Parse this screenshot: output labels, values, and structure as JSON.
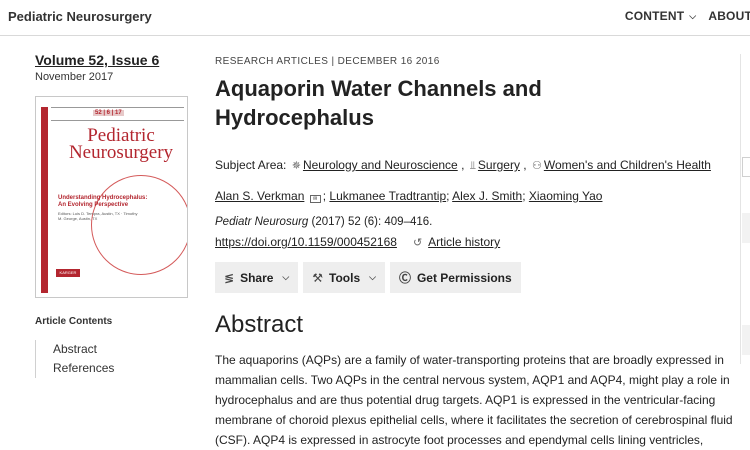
{
  "header": {
    "brand": "Pediatric Neurosurgery",
    "nav": [
      {
        "label": "CONTENT"
      },
      {
        "label": "ABOUT"
      }
    ]
  },
  "issue": {
    "volume": "Volume 52, Issue 6",
    "date": "November 2017"
  },
  "cover": {
    "title_line1": "Pediatric",
    "title_line2": "Neurosurgery",
    "issue_numbers": "52 | 6 | 17",
    "subtitle": "Understanding Hydrocephalus: An Evolving Perspective",
    "editors": "Editors: Luis D. Tempra, Austin, TX · Timothy M. George, Austin, TX",
    "publisher": "KARGER"
  },
  "contents": {
    "heading": "Article Contents",
    "items": [
      {
        "label": "Abstract"
      },
      {
        "label": "References"
      }
    ]
  },
  "article": {
    "kicker": "RESEARCH ARTICLES |  DECEMBER 16 2016",
    "title": "Aquaporin Water Channels and Hydrocephalus",
    "subject_label": "Subject Area:",
    "subjects": [
      {
        "label": "Neurology and Neuroscience"
      },
      {
        "label": "Surgery"
      },
      {
        "label": "Women's and Children's Health"
      }
    ],
    "authors": [
      {
        "name": "Alan S. Verkman"
      },
      {
        "name": "Lukmanee Tradtrantip"
      },
      {
        "name": "Alex J. Smith"
      },
      {
        "name": "Xiaoming Yao"
      }
    ],
    "citation_journal": "Pediatr Neurosurg",
    "citation_rest": " (2017) 52 (6): 409–416.",
    "doi": "https://doi.org/10.1159/000452168",
    "history": "Article history",
    "actions": {
      "share": "Share",
      "tools": "Tools",
      "permissions": "Get Permissions"
    },
    "abstract_heading": "Abstract",
    "abstract_text": "The aquaporins (AQPs) are a family of water-transporting proteins that are broadly expressed in mammalian cells. Two AQPs in the central nervous system, AQP1 and AQP4, might play a role in hydrocephalus and are thus potential drug targets. AQP1 is expressed in the ventricular-facing membrane of choroid plexus epithelial cells, where it facilitates the secretion of cerebrospinal fluid (CSF). AQP4 is expressed in astrocyte foot processes and ependymal cells lining ventricles,"
  },
  "icons": {
    "subject1": "brain-icon",
    "subject2": "scalpel-icon",
    "subject3": "family-icon",
    "history": "clock-icon",
    "share": "share-icon",
    "tools": "wrench-icon",
    "permissions": "copyright-icon"
  }
}
